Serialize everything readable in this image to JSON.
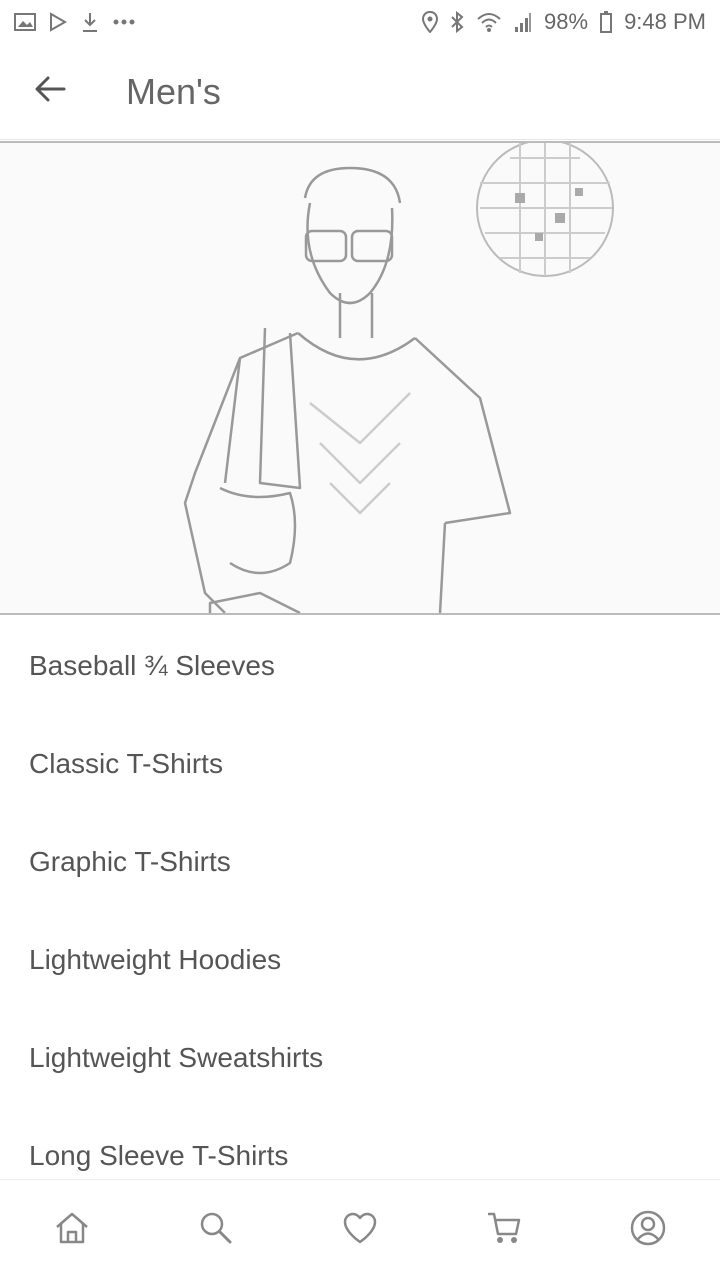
{
  "status_bar": {
    "battery": "98%",
    "time": "9:48 PM",
    "left_icons": [
      "gallery-icon",
      "play-store-icon",
      "download-icon",
      "more-dots-icon"
    ],
    "right_icons": [
      "location-icon",
      "bluetooth-icon",
      "wifi-icon",
      "signal-icon",
      "battery-icon"
    ]
  },
  "header": {
    "title": "Men's",
    "back_icon": "back-arrow-icon"
  },
  "hero": {
    "image": "promo-banner-image"
  },
  "categories": [
    {
      "label": "Baseball ¾ Sleeves"
    },
    {
      "label": "Classic T-Shirts"
    },
    {
      "label": "Graphic T-Shirts"
    },
    {
      "label": "Lightweight Hoodies"
    },
    {
      "label": "Lightweight Sweatshirts"
    },
    {
      "label": "Long Sleeve T-Shirts"
    }
  ],
  "bottom_nav": {
    "items": [
      "home-icon",
      "search-icon",
      "heart-icon",
      "cart-icon",
      "account-icon"
    ]
  },
  "colors": {
    "text": "#555555",
    "icon": "#888888",
    "divider": "#e5e5e5"
  }
}
